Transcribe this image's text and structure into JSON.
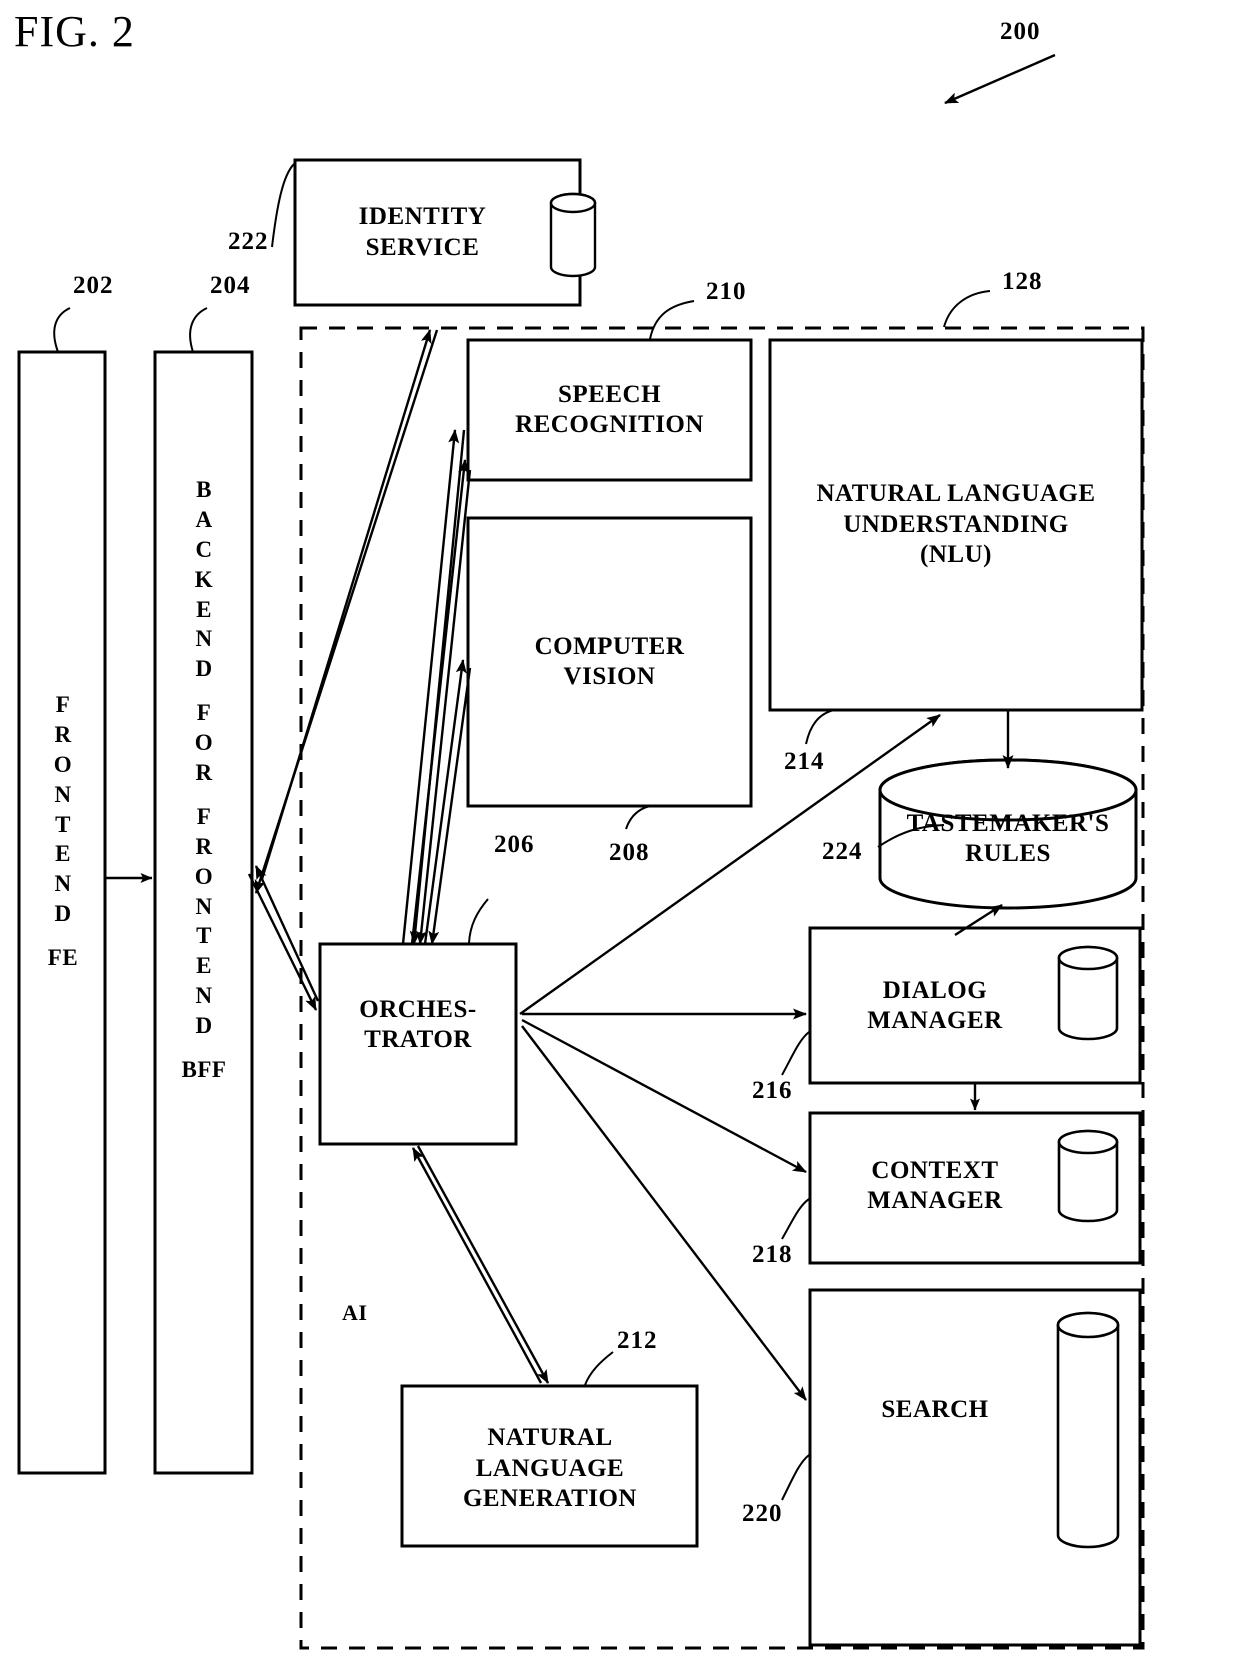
{
  "figure": {
    "title": "FIG. 2",
    "system_ref": "200",
    "ai_container_label": "AI",
    "ai_container_ref": "128"
  },
  "blocks": {
    "identity_service": {
      "label": "IDENTITY\nSERVICE",
      "ref": "222",
      "has_db": true
    },
    "frontend": {
      "letters": [
        "F",
        "R",
        "O",
        "N",
        "T",
        "E",
        "N",
        "D"
      ],
      "abbrev": "FE",
      "ref": "202"
    },
    "bff": {
      "letters": [
        "B",
        "A",
        "C",
        "K",
        "E",
        "N",
        "D",
        "",
        "F",
        "O",
        "R",
        "",
        "F",
        "R",
        "O",
        "N",
        "T",
        "E",
        "N",
        "D"
      ],
      "abbrev": "BFF",
      "ref": "204"
    },
    "speech_recognition": {
      "label": "SPEECH\nRECOGNITION",
      "ref": "210"
    },
    "computer_vision": {
      "label": "COMPUTER\nVISION",
      "ref": "208"
    },
    "nlu": {
      "label": "NATURAL LANGUAGE\nUNDERSTANDING\n(NLU)",
      "ref": "214"
    },
    "orchestrator": {
      "label": "ORCHES-\nTRATOR",
      "ref": "206"
    },
    "tastemakers_rules": {
      "label": "TASTEMAKER'S\nRULES",
      "ref": "224"
    },
    "dialog_manager": {
      "label": "DIALOG\nMANAGER",
      "ref": "216",
      "has_db": true
    },
    "context_manager": {
      "label": "CONTEXT\nMANAGER",
      "ref": "218",
      "has_db": true
    },
    "search": {
      "label": "SEARCH",
      "ref": "220",
      "has_db": true
    },
    "nlg": {
      "label": "NATURAL\nLANGUAGE\nGENERATION",
      "ref": "212"
    }
  },
  "refnums": {
    "n200": "200",
    "n202": "202",
    "n204": "204",
    "n206": "206",
    "n208": "208",
    "n210": "210",
    "n212": "212",
    "n214": "214",
    "n216": "216",
    "n218": "218",
    "n220": "220",
    "n222": "222",
    "n224": "224",
    "n128": "128"
  },
  "colors": {
    "ink": "#000000",
    "paper": "#ffffff"
  },
  "chart_data": {
    "type": "diagram",
    "title": "FIG. 2",
    "nodes": [
      "IDENTITY SERVICE",
      "FRONTEND (FE)",
      "BACKEND FOR FRONTEND (BFF)",
      "SPEECH RECOGNITION",
      "COMPUTER VISION",
      "NATURAL LANGUAGE UNDERSTANDING (NLU)",
      "ORCHESTRATOR",
      "TASTEMAKER'S RULES",
      "DIALOG MANAGER",
      "CONTEXT MANAGER",
      "SEARCH",
      "NATURAL LANGUAGE GENERATION"
    ],
    "edges": [
      {
        "from": "FRONTEND (FE)",
        "to": "BACKEND FOR FRONTEND (BFF)",
        "dir": "one-way"
      },
      {
        "from": "BACKEND FOR FRONTEND (BFF)",
        "to": "IDENTITY SERVICE",
        "dir": "two-way"
      },
      {
        "from": "ORCHESTRATOR",
        "to": "IDENTITY SERVICE",
        "dir": "two-way"
      },
      {
        "from": "ORCHESTRATOR",
        "to": "BACKEND FOR FRONTEND (BFF)",
        "dir": "two-way"
      },
      {
        "from": "ORCHESTRATOR",
        "to": "SPEECH RECOGNITION",
        "dir": "two-way"
      },
      {
        "from": "ORCHESTRATOR",
        "to": "COMPUTER VISION",
        "dir": "two-way"
      },
      {
        "from": "ORCHESTRATOR",
        "to": "NATURAL LANGUAGE UNDERSTANDING (NLU)",
        "dir": "two-way"
      },
      {
        "from": "ORCHESTRATOR",
        "to": "DIALOG MANAGER",
        "dir": "two-way"
      },
      {
        "from": "ORCHESTRATOR",
        "to": "CONTEXT MANAGER",
        "dir": "two-way"
      },
      {
        "from": "ORCHESTRATOR",
        "to": "SEARCH",
        "dir": "two-way"
      },
      {
        "from": "ORCHESTRATOR",
        "to": "NATURAL LANGUAGE GENERATION",
        "dir": "two-way"
      },
      {
        "from": "NATURAL LANGUAGE UNDERSTANDING (NLU)",
        "to": "TASTEMAKER'S RULES",
        "dir": "one-way"
      },
      {
        "from": "TASTEMAKER'S RULES",
        "to": "DIALOG MANAGER",
        "dir": "one-way"
      },
      {
        "from": "DIALOG MANAGER",
        "to": "CONTEXT MANAGER",
        "dir": "one-way"
      }
    ]
  }
}
